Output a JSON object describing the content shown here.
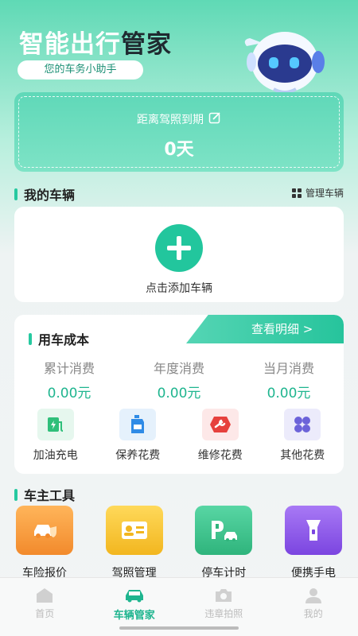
{
  "hero": {
    "title_part1": "智能出行",
    "title_part2": "管家",
    "subtitle": "您的车务小助手"
  },
  "license": {
    "label": "距离驾照到期",
    "value": "0天"
  },
  "vehicles": {
    "section_title": "我的车辆",
    "manage_label": "管理车辆",
    "add_label": "点击添加车辆"
  },
  "cost": {
    "section_title": "用车成本",
    "detail_link": "查看明细 >",
    "stats": [
      {
        "label": "累计消费",
        "value": "0.00元"
      },
      {
        "label": "年度消费",
        "value": "0.00元"
      },
      {
        "label": "当月消费",
        "value": "0.00元"
      }
    ],
    "categories": [
      {
        "label": "加油充电",
        "icon": "fuel-charge-icon"
      },
      {
        "label": "保养花费",
        "icon": "maintenance-icon"
      },
      {
        "label": "维修花费",
        "icon": "repair-icon"
      },
      {
        "label": "其他花费",
        "icon": "other-icon"
      }
    ]
  },
  "tools": {
    "section_title": "车主工具",
    "items": [
      {
        "label": "车险报价",
        "icon": "car-insurance-icon",
        "color": "#f59a3a"
      },
      {
        "label": "驾照管理",
        "icon": "license-card-icon",
        "color": "#f5c232"
      },
      {
        "label": "停车计时",
        "icon": "parking-icon",
        "color": "#3fc590"
      },
      {
        "label": "便携手电",
        "icon": "flashlight-icon",
        "color": "#8f5ce8"
      }
    ]
  },
  "tabbar": {
    "items": [
      {
        "label": "首页",
        "icon": "home-icon"
      },
      {
        "label": "车辆管家",
        "icon": "car-icon"
      },
      {
        "label": "违章拍照",
        "icon": "camera-icon"
      },
      {
        "label": "我的",
        "icon": "profile-icon"
      }
    ]
  }
}
